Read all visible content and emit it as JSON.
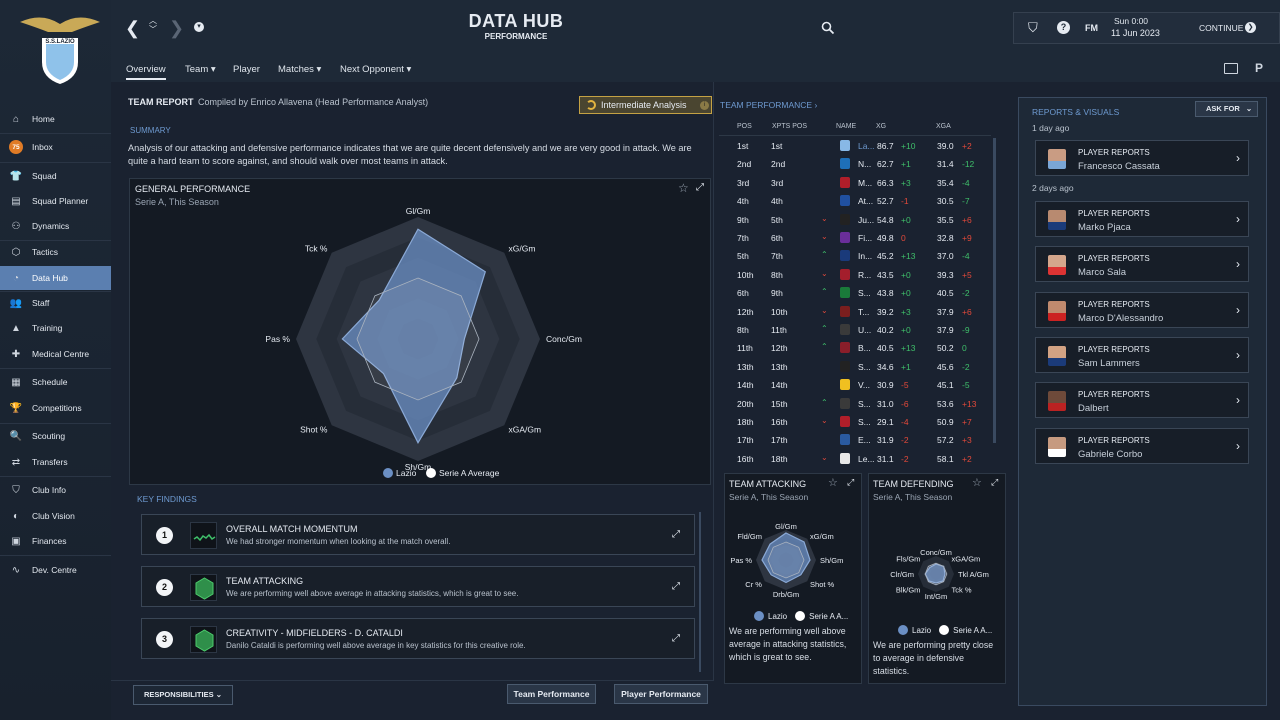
{
  "app": {
    "title": "DATA HUB",
    "subtitle": "PERFORMANCE",
    "date_day": "Sun 0:00",
    "date": "11 Jun 2023",
    "continue_label": "CONTINUE",
    "fm_label": "FM",
    "crest_text": "S.S.LAZIO"
  },
  "sidebar": {
    "items": [
      {
        "label": "Home",
        "icon": "home-icon"
      },
      {
        "label": "Inbox",
        "icon": "inbox-icon",
        "badge": "75"
      },
      {
        "label": "Squad",
        "icon": "shirt-icon"
      },
      {
        "label": "Squad Planner",
        "icon": "clipboard-icon"
      },
      {
        "label": "Dynamics",
        "icon": "dynamics-icon"
      },
      {
        "label": "Tactics",
        "icon": "tactics-icon"
      },
      {
        "label": "Data Hub",
        "icon": "data-hub-icon"
      },
      {
        "label": "Staff",
        "icon": "staff-icon"
      },
      {
        "label": "Training",
        "icon": "training-icon"
      },
      {
        "label": "Medical Centre",
        "icon": "medical-icon"
      },
      {
        "label": "Schedule",
        "icon": "calendar-icon"
      },
      {
        "label": "Competitions",
        "icon": "trophy-icon"
      },
      {
        "label": "Scouting",
        "icon": "search-icon"
      },
      {
        "label": "Transfers",
        "icon": "transfer-icon"
      },
      {
        "label": "Club Info",
        "icon": "shield-icon"
      },
      {
        "label": "Club Vision",
        "icon": "vision-icon"
      },
      {
        "label": "Finances",
        "icon": "finances-icon"
      },
      {
        "label": "Dev. Centre",
        "icon": "dev-centre-icon"
      }
    ],
    "active": "Data Hub"
  },
  "subnav": {
    "tabs": [
      "Overview",
      "Team",
      "Player",
      "Matches",
      "Next Opponent"
    ],
    "active": "Overview"
  },
  "team_report": {
    "title": "TEAM REPORT",
    "compiled_by": "Compiled by Enrico Allavena (Head Performance Analyst)",
    "badge": "Intermediate Analysis",
    "summary_label": "SUMMARY",
    "summary": "Analysis of our attacking and defensive performance indicates that we are quite decent defensively and we are very good in attack. We are quite a hard team to score against, and should walk over most teams in attack."
  },
  "general_performance": {
    "title": "GENERAL PERFORMANCE",
    "subtitle": "Serie A, This Season",
    "axes": [
      "Gl/Gm",
      "xG/Gm",
      "Conc/Gm",
      "xGA/Gm",
      "Sh/Gm",
      "Shot %",
      "Pas %",
      "Tck %"
    ],
    "series": [
      {
        "name": "Lazio",
        "values": [
          0.9,
          0.78,
          0.38,
          0.45,
          0.85,
          0.4,
          0.62,
          0.45
        ],
        "color": "#6b8fc4"
      },
      {
        "name": "Serie A Average",
        "values": [
          0.5,
          0.5,
          0.5,
          0.5,
          0.5,
          0.5,
          0.5,
          0.5
        ],
        "color": "#ffffff"
      }
    ]
  },
  "key_findings": {
    "label": "KEY FINDINGS",
    "items": [
      {
        "num": "1",
        "title": "OVERALL MATCH MOMENTUM",
        "desc": "We had stronger momentum when looking at the match overall."
      },
      {
        "num": "2",
        "title": "TEAM ATTACKING",
        "desc": "We are performing well above average in attacking statistics, which is great to see."
      },
      {
        "num": "3",
        "title": "CREATIVITY - MIDFIELDERS - D. CATALDI",
        "desc": "Danilo Cataldi is performing well above average in key statistics for this creative role."
      }
    ]
  },
  "buttons": {
    "responsibilities": "RESPONSIBILITIES",
    "team_performance": "Team Performance",
    "player_performance": "Player Performance"
  },
  "team_performance": {
    "link": "TEAM PERFORMANCE ›",
    "headers": [
      "POS",
      "XPTS POS",
      "NAME",
      "XG",
      "XGA"
    ],
    "rows": [
      [
        "1st",
        "1st",
        "",
        "La...",
        "86.7",
        "+10",
        "39.0",
        "+2"
      ],
      [
        "2nd",
        "2nd",
        "",
        "N...",
        "62.7",
        "+1",
        "31.4",
        "-12"
      ],
      [
        "3rd",
        "3rd",
        "",
        "M...",
        "66.3",
        "+3",
        "35.4",
        "-4"
      ],
      [
        "4th",
        "4th",
        "",
        "At...",
        "52.7",
        "-1",
        "30.5",
        "-7"
      ],
      [
        "9th",
        "5th",
        "down",
        "Ju...",
        "54.8",
        "+0",
        "35.5",
        "+6"
      ],
      [
        "7th",
        "6th",
        "down",
        "Fi...",
        "49.8",
        "0",
        "32.8",
        "+9"
      ],
      [
        "5th",
        "7th",
        "up",
        "In...",
        "45.2",
        "+13",
        "37.0",
        "-4"
      ],
      [
        "10th",
        "8th",
        "down",
        "R...",
        "43.5",
        "+0",
        "39.3",
        "+5"
      ],
      [
        "6th",
        "9th",
        "up",
        "S...",
        "43.8",
        "+0",
        "40.5",
        "-2"
      ],
      [
        "12th",
        "10th",
        "down",
        "T...",
        "39.2",
        "+3",
        "37.9",
        "+6"
      ],
      [
        "8th",
        "11th",
        "up",
        "U...",
        "40.2",
        "+0",
        "37.9",
        "-9"
      ],
      [
        "11th",
        "12th",
        "up",
        "B...",
        "40.5",
        "+13",
        "50.2",
        "0"
      ],
      [
        "13th",
        "13th",
        "",
        "S...",
        "34.6",
        "+1",
        "45.6",
        "-2"
      ],
      [
        "14th",
        "14th",
        "",
        "V...",
        "30.9",
        "-5",
        "45.1",
        "-5"
      ],
      [
        "20th",
        "15th",
        "up",
        "S...",
        "31.0",
        "-6",
        "53.6",
        "+13"
      ],
      [
        "18th",
        "16th",
        "down",
        "S...",
        "29.1",
        "-4",
        "50.9",
        "+7"
      ],
      [
        "17th",
        "17th",
        "",
        "E...",
        "31.9",
        "-2",
        "57.2",
        "+3"
      ],
      [
        "16th",
        "18th",
        "down",
        "Le...",
        "31.1",
        "-2",
        "58.1",
        "+2"
      ]
    ]
  },
  "team_attacking": {
    "title": "TEAM ATTACKING",
    "subtitle": "Serie A, This Season",
    "axes": [
      "Gl/Gm",
      "xG/Gm",
      "Sh/Gm",
      "Shot %",
      "Drb/Gm",
      "Cr %",
      "Pas %",
      "Fld/Gm"
    ],
    "legend": [
      "Lazio",
      "Serie A A..."
    ],
    "text": "We are performing well above average in attacking statistics, which is great to see."
  },
  "team_defending": {
    "title": "TEAM DEFENDING",
    "subtitle": "Serie A, This Season",
    "axes": [
      "Conc/Gm",
      "xGA/Gm",
      "Tkl A/Gm",
      "Tck %",
      "Int/Gm",
      "Blk/Gm",
      "Clr/Gm",
      "Fls/Gm"
    ],
    "legend": [
      "Lazio",
      "Serie A A..."
    ],
    "text": "We are performing pretty close to average in defensive statistics."
  },
  "reports": {
    "title": "REPORTS & VISUALS",
    "ask_for": "ASK FOR",
    "groups": [
      {
        "when": "1 day ago",
        "items": [
          {
            "type": "PLAYER REPORTS",
            "name": "Francesco Cassata"
          }
        ]
      },
      {
        "when": "2 days ago",
        "items": [
          {
            "type": "PLAYER REPORTS",
            "name": "Marko Pjaca"
          },
          {
            "type": "PLAYER REPORTS",
            "name": "Marco Sala"
          },
          {
            "type": "PLAYER REPORTS",
            "name": "Marco D'Alessandro"
          },
          {
            "type": "PLAYER REPORTS",
            "name": "Sam Lammers"
          },
          {
            "type": "PLAYER REPORTS",
            "name": "Dalbert"
          },
          {
            "type": "PLAYER REPORTS",
            "name": "Gabriele Corbo"
          }
        ]
      }
    ]
  }
}
